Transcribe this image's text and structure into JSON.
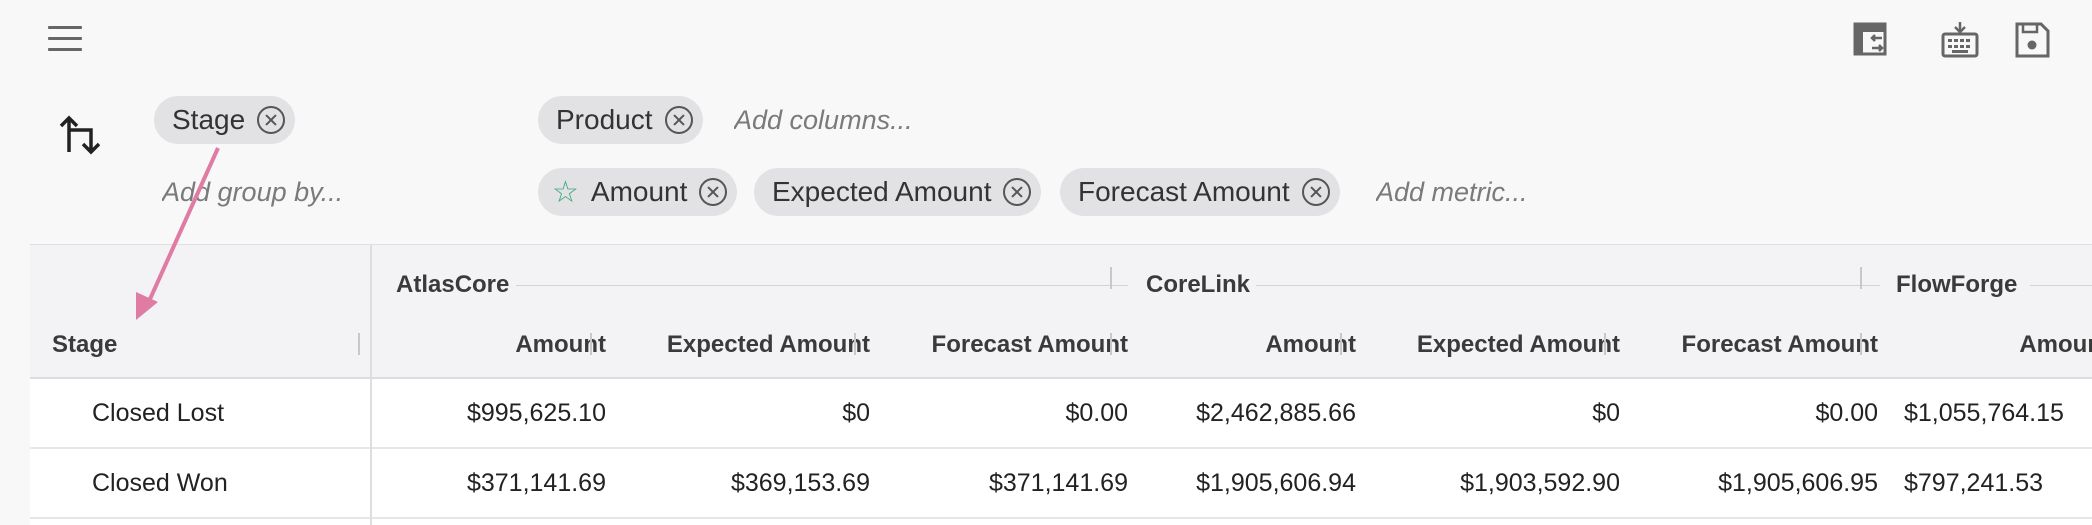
{
  "toolbar": {
    "menu_icon": "hamburger-menu-icon",
    "icons": [
      "pivot-table-swap-icon",
      "keyboard-icon",
      "save-icon"
    ]
  },
  "pivot": {
    "swap_icon": "swap-axes-icon",
    "group_by": [
      {
        "label": "Stage"
      }
    ],
    "group_by_placeholder": "Add group by...",
    "columns": [
      {
        "label": "Product"
      }
    ],
    "columns_placeholder": "Add columns...",
    "metrics": [
      {
        "label": "Amount",
        "starred": true
      },
      {
        "label": "Expected Amount",
        "starred": false
      },
      {
        "label": "Forecast Amount",
        "starred": false
      }
    ],
    "metric_placeholder": "Add metric..."
  },
  "colors": {
    "star": "#3aa97a",
    "arrow": "#e07ba3",
    "chip_bg": "#e2e2e4"
  },
  "grid": {
    "stage_header": "Stage",
    "groups": [
      "AtlasCore",
      "CoreLink",
      "FlowForge"
    ],
    "metric_headers": [
      "Amount",
      "Expected Amount",
      "Forecast Amount",
      "Amount",
      "Expected Amount",
      "Forecast Amount",
      "Amount"
    ],
    "rows": [
      {
        "stage": "Closed Lost",
        "values": [
          "$995,625.10",
          "$0",
          "$0.00",
          "$2,462,885.66",
          "$0",
          "$0.00",
          "$1,055,764.15"
        ]
      },
      {
        "stage": "Closed Won",
        "values": [
          "$371,141.69",
          "$369,153.69",
          "$371,141.69",
          "$1,905,606.94",
          "$1,903,592.90",
          "$1,905,606.95",
          "$797,241.53"
        ]
      }
    ]
  }
}
